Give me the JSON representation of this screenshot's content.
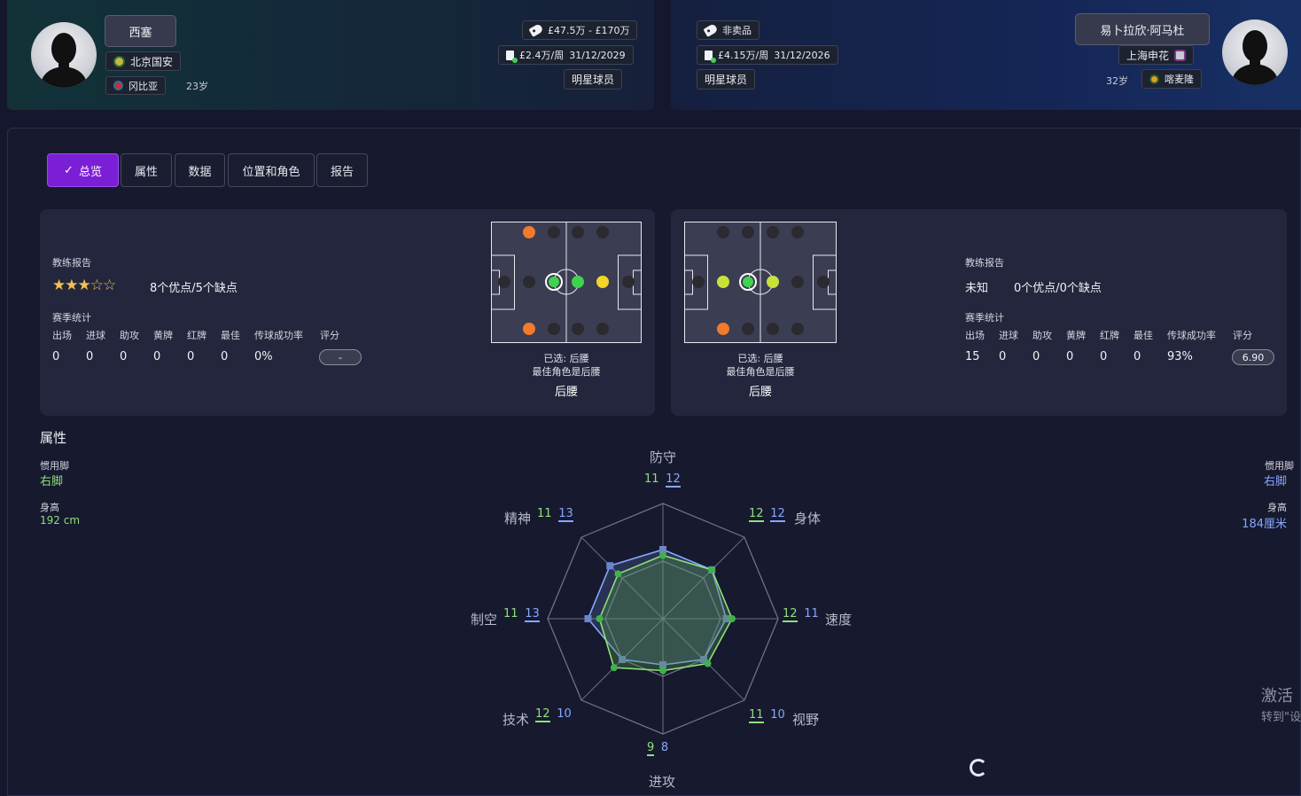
{
  "colors": {
    "accent": "#7b1fd7",
    "player_a": "#8fe07b",
    "player_b": "#86a8ff"
  },
  "player_a": {
    "name": "西塞",
    "club": "北京国安",
    "nation": "冈比亚",
    "age": "23岁",
    "value": "£47.5万 - £170万",
    "wage": "£2.4万/周",
    "contract_end": "31/12/2029",
    "status": "明星球员",
    "coach_report_label": "教练报告",
    "stars": "★★★☆☆",
    "report_summary": "8个优点/5个缺点",
    "season_stats_label": "赛季统计",
    "stat_headers": [
      "出场",
      "进球",
      "助攻",
      "黄牌",
      "红牌",
      "最佳",
      "传球成功率",
      "评分"
    ],
    "stat_values": [
      "0",
      "0",
      "0",
      "0",
      "0",
      "0",
      "0%"
    ],
    "rating": "-",
    "pitch_selected": "已选: 后腰",
    "pitch_best": "最佳角色是后腰",
    "pitch_role": "后腰",
    "preferred_foot_label": "惯用脚",
    "preferred_foot": "右脚",
    "height_label": "身高",
    "height": "192 cm"
  },
  "player_b": {
    "name": "易卜拉欣·阿马杜",
    "club": "上海申花",
    "nation": "喀麦隆",
    "age": "32岁",
    "value": "非卖品",
    "wage": "£4.15万/周",
    "contract_end": "31/12/2026",
    "status": "明星球员",
    "coach_report_label": "教练报告",
    "report_known": "未知",
    "report_summary": "0个优点/0个缺点",
    "season_stats_label": "赛季统计",
    "stat_headers": [
      "出场",
      "进球",
      "助攻",
      "黄牌",
      "红牌",
      "最佳",
      "传球成功率",
      "评分"
    ],
    "stat_values": [
      "15",
      "0",
      "0",
      "0",
      "0",
      "0",
      "93%"
    ],
    "rating": "6.90",
    "pitch_selected": "已选: 后腰",
    "pitch_best": "最佳角色是后腰",
    "pitch_role": "后腰",
    "preferred_foot_label": "惯用脚",
    "preferred_foot": "右脚",
    "height_label": "身高",
    "height": "184厘米"
  },
  "tabs": [
    {
      "label": "总览",
      "active": true
    },
    {
      "label": "属性"
    },
    {
      "label": "数据"
    },
    {
      "label": "位置和角色"
    },
    {
      "label": "报告"
    }
  ],
  "attributes_title": "属性",
  "radar": {
    "max": 20,
    "axes": [
      {
        "label": "防守",
        "a": 11,
        "b": 12
      },
      {
        "label": "身体",
        "a": 12,
        "b": 12
      },
      {
        "label": "速度",
        "a": 12,
        "b": 11
      },
      {
        "label": "视野",
        "a": 11,
        "b": 10
      },
      {
        "label": "进攻",
        "a": 9,
        "b": 8
      },
      {
        "label": "技术",
        "a": 12,
        "b": 10
      },
      {
        "label": "制空",
        "a": 11,
        "b": 13
      },
      {
        "label": "精神",
        "a": 11,
        "b": 13
      }
    ]
  },
  "watermark": {
    "line1": "激活",
    "line2": "转到\"设"
  }
}
